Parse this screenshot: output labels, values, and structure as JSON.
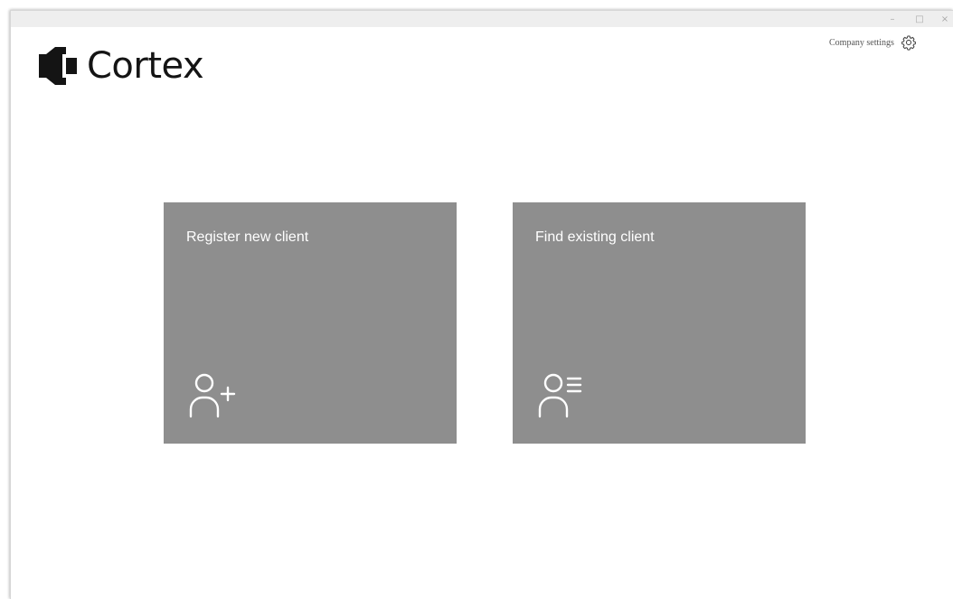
{
  "window": {
    "controls": {
      "minimize": "–",
      "maximize": "□",
      "close": "×"
    }
  },
  "header": {
    "logo_text": "Cortex",
    "company_settings_label": "Company settings",
    "settings_icon": "gear-icon"
  },
  "cards": {
    "register": {
      "title": "Register new client",
      "icon": "user-add-icon"
    },
    "find": {
      "title": "Find existing client",
      "icon": "user-list-icon"
    }
  },
  "colors": {
    "card_background": "#8e8e8e",
    "card_text": "#ffffff",
    "logo": "#141414",
    "titlebar": "#eeeeee"
  }
}
